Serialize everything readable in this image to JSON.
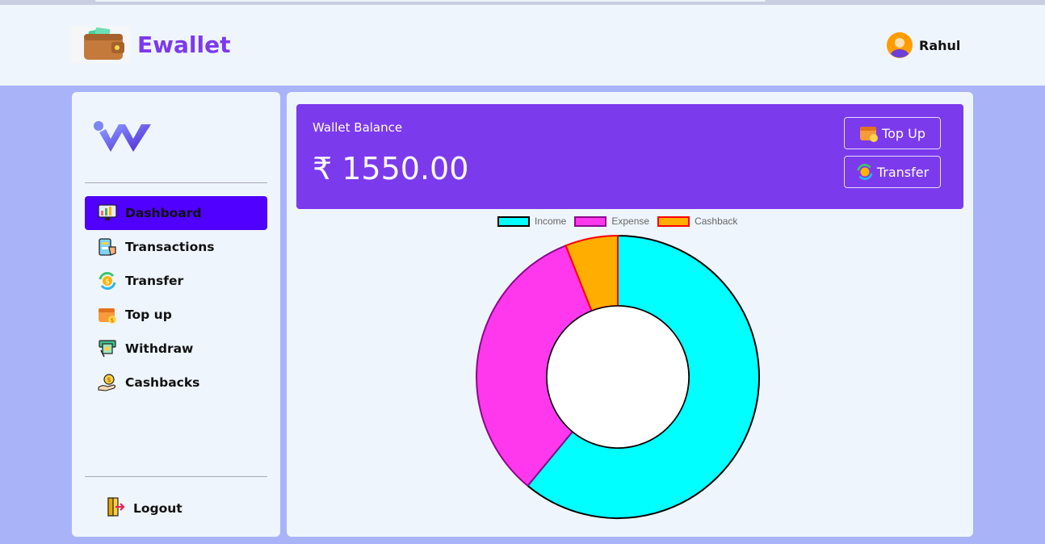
{
  "app": {
    "title": "Ewallet"
  },
  "user": {
    "name": "Rahul"
  },
  "sidebar": {
    "items": [
      {
        "label": "Dashboard",
        "icon": "dashboard-icon",
        "active": true
      },
      {
        "label": "Transactions",
        "icon": "transactions-icon",
        "active": false
      },
      {
        "label": "Transfer",
        "icon": "transfer-icon",
        "active": false
      },
      {
        "label": "Top up",
        "icon": "topup-icon",
        "active": false
      },
      {
        "label": "Withdraw",
        "icon": "withdraw-icon",
        "active": false
      },
      {
        "label": "Cashbacks",
        "icon": "cashback-icon",
        "active": false
      }
    ],
    "logout_label": "Logout"
  },
  "wallet": {
    "label": "Wallet Balance",
    "amount": "₹ 1550.00",
    "topup_label": "Top Up",
    "transfer_label": "Transfer"
  },
  "colors": {
    "brand": "#7c3aed",
    "active_nav": "#4f00ff",
    "income": "#00ffff",
    "expense": "#ff38ed",
    "cashback": "#ffae00"
  },
  "chart_data": {
    "type": "pie",
    "variant": "doughnut",
    "categories": [
      "Income",
      "Expense",
      "Cashback"
    ],
    "values": [
      61,
      33,
      6
    ],
    "colors": [
      "#00ffff",
      "#ff38ed",
      "#ffae00"
    ],
    "borders": [
      "#000000",
      "#8b0a8b",
      "#ff0000"
    ],
    "legend": "top"
  }
}
